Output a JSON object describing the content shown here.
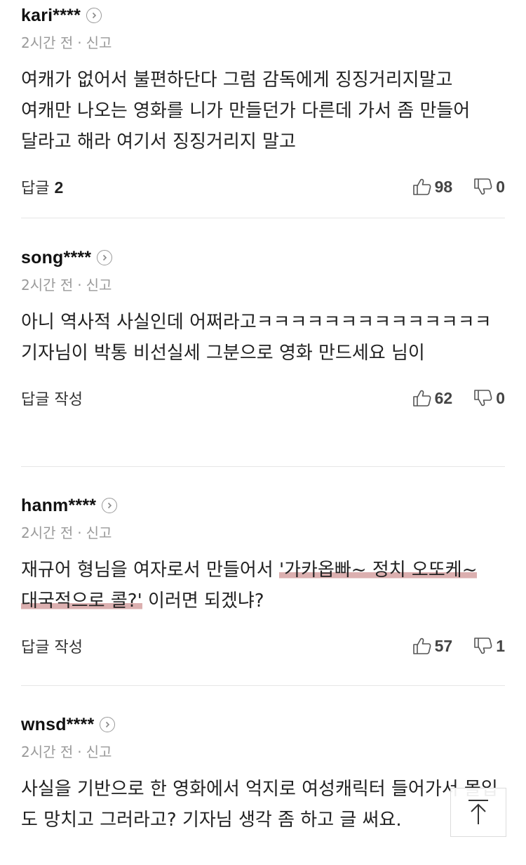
{
  "comments": [
    {
      "author": "kari****",
      "time": "2시간 전",
      "report": "신고",
      "text": "여캐가 없어서 불편하단다 그럼 감독에게 징징거리지말고 여캐만 나오는 영화를 니가 만들던가 다른데 가서 좀 만들어 달라고 해라 여기서 징징거리지 말고",
      "reply_label": "답글",
      "reply_count": "2",
      "likes": "98",
      "dislikes": "0"
    },
    {
      "author": "song****",
      "time": "2시간 전",
      "report": "신고",
      "text": "아니 역사적 사실인데 어쩌라고ㅋㅋㅋㅋㅋㅋㅋㅋㅋㅋㅋㅋㅋㅋ 기자님이 박통 비선실세 그분으로 영화 만드세요 님이",
      "reply_label": "답글 작성",
      "likes": "62",
      "dislikes": "0"
    },
    {
      "author": "hanm****",
      "time": "2시간 전",
      "report": "신고",
      "text_before": "재규어 형님을 여자로서 만들어서 ",
      "text_highlight": "'가카옵빠~ 정치 오또케~ 대국적으로 콜?'",
      "text_after": " 이러면 되겠냐?",
      "reply_label": "답글 작성",
      "likes": "57",
      "dislikes": "1"
    },
    {
      "author": "wnsd****",
      "time": "2시간 전",
      "report": "신고",
      "text": "사실을 기반으로 한 영화에서 억지로 여성캐릭터 들어가서 몰입도 망치고 그러라고? 기자님 생각 좀 하고 글 써요."
    }
  ],
  "scroll_top_icon": "arrow-up-icon"
}
